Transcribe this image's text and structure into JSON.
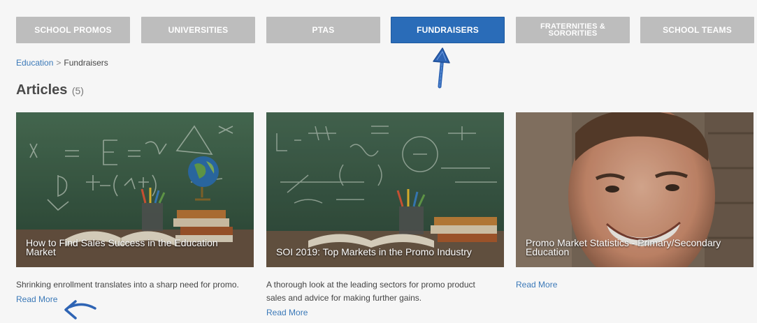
{
  "tabs": [
    {
      "label": "SCHOOL PROMOS"
    },
    {
      "label": "UNIVERSITIES"
    },
    {
      "label": "PTAS"
    },
    {
      "label": "FUNDRAISERS"
    },
    {
      "label": "FRATERNITIES &\nSORORITIES"
    },
    {
      "label": "SCHOOL TEAMS"
    }
  ],
  "active_tab": "FUNDRAISERS",
  "breadcrumb": {
    "parent": "Education",
    "separator": ">",
    "current": "Fundraisers"
  },
  "articles": {
    "title": "Articles",
    "count": "(5)",
    "items": [
      {
        "title": "How to Find Sales Success in the Education Market",
        "description": "Shrinking enrollment translates into a sharp need for promo.",
        "link": "Read More"
      },
      {
        "title": "SOI 2019: Top Markets in the Promo Industry",
        "description": "A thorough look at the leading sectors for promo product sales and advice for making further gains.",
        "link": "Read More"
      },
      {
        "title": "Promo Market Statistics - Primary/Secondary Education",
        "description": "",
        "link": "Read More"
      }
    ]
  },
  "colors": {
    "tab_inactive": "#bdbdbd",
    "tab_active": "#2a6cb8",
    "link": "#3b79b8",
    "annotation": "#2e64b4"
  },
  "icons": [
    "up-arrow-annotation-icon",
    "left-arrow-annotation-icon"
  ]
}
